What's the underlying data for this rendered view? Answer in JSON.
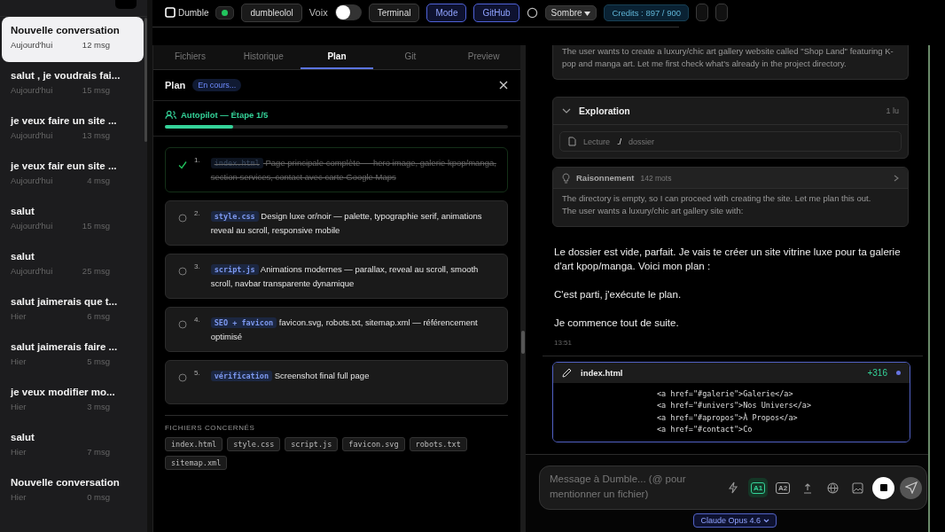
{
  "sidebar": {
    "conversations": [
      {
        "title": "Nouvelle conversation",
        "date": "Aujourd'hui",
        "count": "12 msg",
        "selected": true
      },
      {
        "title": "salut , je voudrais fai...",
        "date": "Aujourd'hui",
        "count": "15 msg",
        "selected": false
      },
      {
        "title": "je veux faire un site ...",
        "date": "Aujourd'hui",
        "count": "13 msg",
        "selected": false
      },
      {
        "title": "je veux fair eun site ...",
        "date": "Aujourd'hui",
        "count": "4 msg",
        "selected": false
      },
      {
        "title": "salut",
        "date": "Aujourd'hui",
        "count": "15 msg",
        "selected": false
      },
      {
        "title": "salut",
        "date": "Aujourd'hui",
        "count": "25 msg",
        "selected": false
      },
      {
        "title": "salut jaimerais que t...",
        "date": "Hier",
        "count": "6 msg",
        "selected": false
      },
      {
        "title": "salut jaimerais faire ...",
        "date": "Hier",
        "count": "5 msg",
        "selected": false
      },
      {
        "title": "je veux modifier mo...",
        "date": "Hier",
        "count": "3 msg",
        "selected": false
      },
      {
        "title": "salut",
        "date": "Hier",
        "count": "7 msg",
        "selected": false
      },
      {
        "title": "Nouvelle conversation",
        "date": "Hier",
        "count": "0 msg",
        "selected": false
      }
    ]
  },
  "topbar": {
    "logo": "Dumble",
    "online": true,
    "project": "dumbleolol",
    "voice_label": "Voix",
    "voice_on": false,
    "buttons": [
      {
        "label": "Terminal",
        "selected": false
      },
      {
        "label": "Mode",
        "selected": true
      },
      {
        "label": "GitHub",
        "selected": true
      }
    ],
    "theme": "Sombre",
    "credits": "Credits : 897 / 900"
  },
  "panel": {
    "tabs": [
      {
        "label": "Fichiers",
        "selected": false
      },
      {
        "label": "Historique",
        "selected": false
      },
      {
        "label": "Plan",
        "selected": true
      },
      {
        "label": "Git",
        "selected": false
      },
      {
        "label": "Preview",
        "selected": false
      }
    ],
    "title": "Plan",
    "status": "En cours...",
    "autopilot": "Autopilot — Étape 1/5",
    "level": 0.2,
    "steps": [
      {
        "number": "1.",
        "tag": "index.html",
        "text": "Page principale complète — hero image, galerie kpop/manga, section services, contact avec carte Google Maps",
        "done": true
      },
      {
        "number": "2.",
        "tag": "style.css",
        "text": "Design luxe or/noir — palette, typographie serif, animations reveal au scroll, responsive mobile",
        "done": false
      },
      {
        "number": "3.",
        "tag": "script.js",
        "text": "Animations modernes — parallax, reveal au scroll, smooth scroll, navbar transparente dynamique",
        "done": false
      },
      {
        "number": "4.",
        "tag": "SEO + favicon",
        "text": "favicon.svg, robots.txt, sitemap.xml — référencement optimisé",
        "done": false
      },
      {
        "number": "5.",
        "tag": "vérification",
        "text": "Screenshot final full page",
        "done": false
      }
    ],
    "files_heading": "FICHIERS CONCERNÉS",
    "files": [
      "index.html",
      "style.css",
      "script.js",
      "favicon.svg",
      "robots.txt",
      "sitemap.xml"
    ]
  },
  "chat": {
    "thinking_top": "The user wants to create a luxury/chic art gallery website called \"Shop Land\" featuring K-pop and manga art. Let me first check what's already in the project directory.",
    "exploration": {
      "title": "Exploration",
      "count": "1 lu",
      "expanded": true,
      "action": "Lecture",
      "path": "./",
      "target": "dossier"
    },
    "reasoning": {
      "title": "Raisonnement",
      "words": "142 mots",
      "expanded": false,
      "text": "The directory is empty, so I can proceed with creating the site. Let me plan this out.",
      "text2": "The user wants a luxury/chic art gallery site with:"
    },
    "messages": [
      "Le dossier est vide, parfait. Je vais te créer un site vitrine luxe pour ta galerie d'art kpop/manga. Voici mon plan :",
      "C'est parti, j'exécute le plan.",
      "Je commence tout de suite."
    ],
    "time": "13:51",
    "file_card": {
      "name": "index.html",
      "added": "+316",
      "lines": [
        "<a href=\"#galerie\">Galerie</a>",
        "<a href=\"#univers\">Nos Univers</a>",
        "<a href=\"#apropos\">À Propos</a>",
        "<a href=\"#contact\">Co"
      ]
    },
    "input": {
      "placeholder": "Message à Dumble... (@ pour mentionner un fichier)"
    },
    "tools": [
      {
        "kind": "bolt",
        "selected": false
      },
      {
        "kind": "a1",
        "label": "A1",
        "selected": true
      },
      {
        "kind": "a2",
        "label": "A2",
        "selected": false
      },
      {
        "kind": "upload",
        "selected": false
      },
      {
        "kind": "globe",
        "selected": false
      },
      {
        "kind": "image",
        "selected": false
      }
    ],
    "model": "Claude Opus 4.6"
  }
}
